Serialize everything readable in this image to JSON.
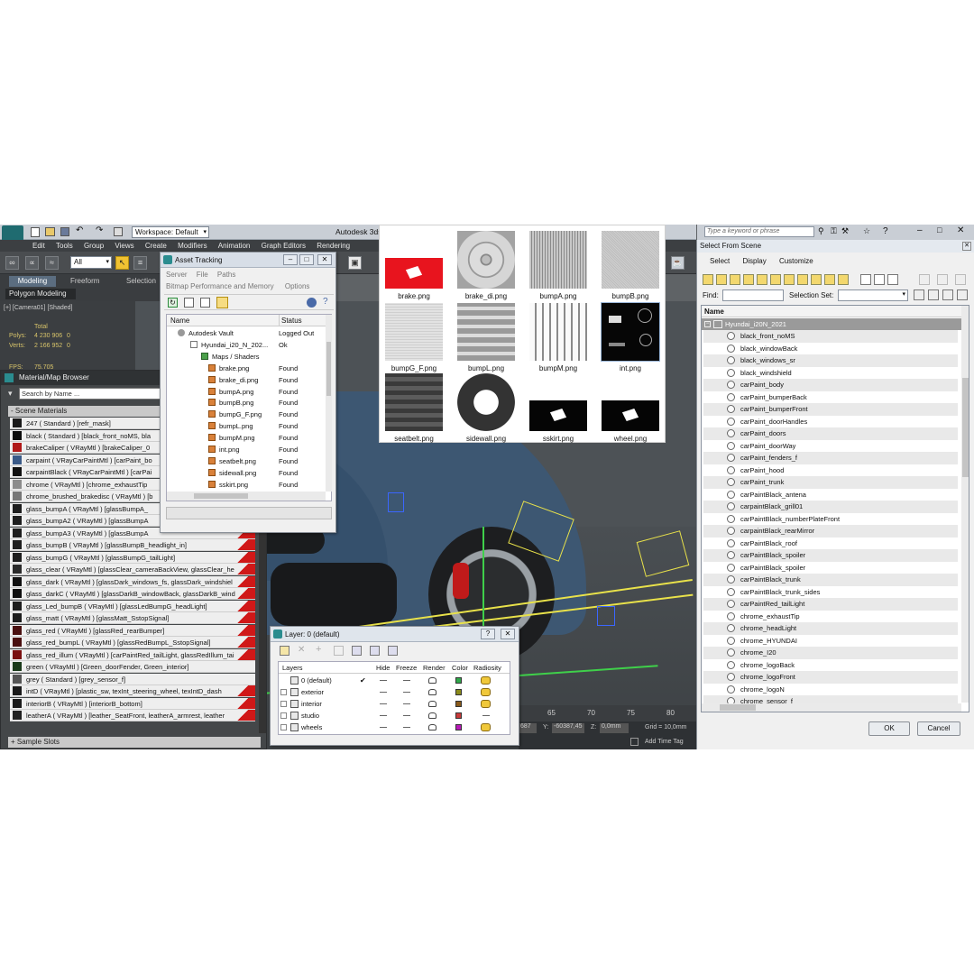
{
  "app": {
    "title": "Autodesk 3ds",
    "workspace": "Workspace: Default",
    "menu": [
      "Edit",
      "Tools",
      "Group",
      "Views",
      "Create",
      "Modifiers",
      "Animation",
      "Graph Editors",
      "Rendering"
    ],
    "filter_all": "All",
    "ribbon_tabs": [
      "Modeling",
      "Freeform",
      "Selection"
    ],
    "ribbon_sub": "Polygon Modeling",
    "search_placeholder": "Type a keyword or phrase"
  },
  "viewport": {
    "label": "[+] [Camera01] [Shaded]",
    "total_label": "Total",
    "polys_label": "Polys:",
    "polys_value": "4 230 906",
    "polys_sel": "0",
    "verts_label": "Verts:",
    "verts_value": "2 166 952",
    "verts_sel": "0",
    "fps_label": "FPS:",
    "fps_value": "75.705"
  },
  "timeline": {
    "ticks": [
      "65",
      "70",
      "75",
      "80"
    ],
    "x_value": "687",
    "y_label": "Y:",
    "y_value": "-60387,45",
    "z_label": "Z:",
    "z_value": "0,0mm",
    "grid": "Grid = 10,0mm",
    "add_time_tag": "Add Time Tag"
  },
  "material_browser": {
    "title": "Material/Map Browser",
    "search_placeholder": "Search by Name ...",
    "section": "- Scene Materials",
    "footer": "+ Sample Slots",
    "items": [
      {
        "label": "247 ( Standard ) [refr_mask]",
        "swatch": "#1a1a1a",
        "red": false
      },
      {
        "label": "black ( Standard ) [black_front_noMS, bla",
        "swatch": "#0c0c0c",
        "red": false
      },
      {
        "label": "brakeCaliper ( VRayMtl ) [brakeCaliper_0",
        "swatch": "#b01818",
        "red": false
      },
      {
        "label": "carpaint ( VRayCarPaintMtl ) [carPaint_bo",
        "swatch": "#3a5a88",
        "red": false
      },
      {
        "label": "carpaintBlack ( VRayCarPaintMtl ) [carPai",
        "swatch": "#111111",
        "red": false
      },
      {
        "label": "chrome ( VRayMtl ) [chrome_exhaustTip",
        "swatch": "#8c8c8c",
        "red": false
      },
      {
        "label": "chrome_brushed_brakedisc ( VRayMtl ) [b",
        "swatch": "#777777",
        "red": false
      },
      {
        "label": "glass_bumpA ( VRayMtl ) [glassBumpA_",
        "swatch": "#1e1e1e",
        "red": true
      },
      {
        "label": "glass_bumpA2 ( VRayMtl ) [glassBumpA",
        "swatch": "#1e1e1e",
        "red": true
      },
      {
        "label": "glass_bumpA3 ( VRayMtl ) [glassBumpA",
        "swatch": "#1e1e1e",
        "red": true
      },
      {
        "label": "glass_bumpB ( VRayMtl ) [glassBumpB_headlight_in]",
        "swatch": "#1e1e1e",
        "red": true
      },
      {
        "label": "glass_bumpG ( VRayMtl ) [glassBumpG_tailLight]",
        "swatch": "#1e1e1e",
        "red": true
      },
      {
        "label": "glass_clear ( VRayMtl ) [glassClear_cameraBackView, glassClear_he",
        "swatch": "#2a2a2a",
        "red": true
      },
      {
        "label": "glass_dark ( VRayMtl ) [glassDark_windows_fs, glassDark_windshiel",
        "swatch": "#101010",
        "red": true
      },
      {
        "label": "glass_darkC ( VRayMtl ) [glassDarkB_windowBack, glassDarkB_wind",
        "swatch": "#101010",
        "red": true
      },
      {
        "label": "glass_Led_bumpB ( VRayMtl ) [glassLedBumpG_headLight]",
        "swatch": "#1e1e1e",
        "red": true
      },
      {
        "label": "glass_matt ( VRayMtl ) [glassMatt_SstopSignal]",
        "swatch": "#1e1e1e",
        "red": true
      },
      {
        "label": "glass_red ( VRayMtl ) [glassRed_rearBumper]",
        "swatch": "#4a1010",
        "red": true
      },
      {
        "label": "glass_red_bumpL ( VRayMtl ) [glassRedBumpL_SstopSignal]",
        "swatch": "#4a1010",
        "red": true
      },
      {
        "label": "glass_red_illum ( VRayMtl ) [carPaintRed_tailLight, glassRedIllum_tai",
        "swatch": "#7a1010",
        "red": true
      },
      {
        "label": "green ( VRayMtl ) [Green_doorFender, Green_interior]",
        "swatch": "#1a3a1a",
        "red": false
      },
      {
        "label": "grey ( Standard ) [grey_sensor_f]",
        "swatch": "#555555",
        "red": false
      },
      {
        "label": "intD ( VRayMtl ) [plastic_sw, texInt_steering_wheel, texIntD_dash",
        "swatch": "#1a1a1a",
        "red": true
      },
      {
        "label": "interiorB ( VRayMtl ) [interiorB_bottom]",
        "swatch": "#1a1a1a",
        "red": true
      },
      {
        "label": "leatherA ( VRayMtl ) [leather_SeatFront, leatherA_armrest, leather",
        "swatch": "#202020",
        "red": true
      }
    ]
  },
  "asset_tracking": {
    "title": "Asset Tracking",
    "menu": [
      "Server",
      "File",
      "Paths"
    ],
    "submenu": [
      "Bitmap Performance and Memory",
      "Options"
    ],
    "col_name": "Name",
    "col_status": "Status",
    "rows": [
      {
        "name": "Autodesk Vault",
        "status": "Logged Out",
        "indent": 1
      },
      {
        "name": "Hyundai_i20_N_202...",
        "status": "Ok",
        "indent": 2
      },
      {
        "name": "Maps / Shaders",
        "status": "",
        "indent": 3
      },
      {
        "name": "brake.png",
        "status": "Found",
        "indent": 4
      },
      {
        "name": "brake_di.png",
        "status": "Found",
        "indent": 4
      },
      {
        "name": "bumpA.png",
        "status": "Found",
        "indent": 4
      },
      {
        "name": "bumpB.png",
        "status": "Found",
        "indent": 4
      },
      {
        "name": "bumpG_F.png",
        "status": "Found",
        "indent": 4
      },
      {
        "name": "bumpL.png",
        "status": "Found",
        "indent": 4
      },
      {
        "name": "bumpM.png",
        "status": "Found",
        "indent": 4
      },
      {
        "name": "int.png",
        "status": "Found",
        "indent": 4
      },
      {
        "name": "seatbelt.png",
        "status": "Found",
        "indent": 4
      },
      {
        "name": "sidewall.png",
        "status": "Found",
        "indent": 4
      },
      {
        "name": "sskirt.png",
        "status": "Found",
        "indent": 4
      },
      {
        "name": "wheel.png",
        "status": "Found",
        "indent": 4
      }
    ]
  },
  "textures": [
    {
      "label": "brake.png",
      "kind": "logo-red"
    },
    {
      "label": "brake_di.png",
      "kind": "disc"
    },
    {
      "label": "bumpA.png",
      "kind": "stripes-fine"
    },
    {
      "label": "bumpB.png",
      "kind": "noise"
    },
    {
      "label": "bumpG_F.png",
      "kind": "grid"
    },
    {
      "label": "bumpL.png",
      "kind": "stripes-h"
    },
    {
      "label": "bumpM.png",
      "kind": "stripes-v"
    },
    {
      "label": "int.png",
      "kind": "dark-atlas"
    },
    {
      "label": "seatbelt.png",
      "kind": "belt"
    },
    {
      "label": "sidewall.png",
      "kind": "tire"
    },
    {
      "label": "sskirt.png",
      "kind": "logo-black"
    },
    {
      "label": "wheel.png",
      "kind": "logo-black"
    }
  ],
  "layer_dialog": {
    "title": "Layer: 0 (default)",
    "help": "?",
    "close": "✕",
    "headers": [
      "Layers",
      "Hide",
      "Freeze",
      "Render",
      "Color",
      "Radiosity"
    ],
    "rows": [
      {
        "name": "0 (default)",
        "color": "#2fa84a",
        "active": true
      },
      {
        "name": "exterior",
        "color": "#8a8a1a",
        "active": false
      },
      {
        "name": "interior",
        "color": "#8a5a1a",
        "active": false
      },
      {
        "name": "studio",
        "color": "#c83a3a",
        "active": false
      },
      {
        "name": "wheels",
        "color": "#b81ab8",
        "active": false
      }
    ]
  },
  "select_from_scene": {
    "title": "Select From Scene",
    "tabs": [
      "Select",
      "Display",
      "Customize"
    ],
    "find_label": "Find:",
    "selection_set_label": "Selection Set:",
    "col_name": "Name",
    "root": "Hyundai_i20N_2021",
    "items": [
      "black_front_noMS",
      "black_windowBack",
      "black_windows_sr",
      "black_windshield",
      "carPaint_body",
      "carPaint_bumperBack",
      "carPaint_bumperFront",
      "carPaint_doorHandles",
      "carPaint_doors",
      "carPaint_doorWay",
      "carPaint_fenders_f",
      "carPaint_hood",
      "carPaint_trunk",
      "carPaintBlack_antena",
      "carpaintBlack_grill01",
      "carPaintBlack_numberPlateFront",
      "carpaintBlack_rearMirror",
      "carPaintBlack_roof",
      "carPaintBlack_spoiler",
      "carPaintBlack_spoiler",
      "carPaintBlack_trunk",
      "carPaintBlack_trunk_sides",
      "carPaintRed_tailLight",
      "chrome_exhaustTip",
      "chrome_headLight",
      "chrome_HYUNDAI",
      "chrome_I20",
      "chrome_logoBack",
      "chrome_logoFront",
      "chrome_logoN",
      "chrome_sensor_f"
    ],
    "ok": "OK",
    "cancel": "Cancel"
  }
}
